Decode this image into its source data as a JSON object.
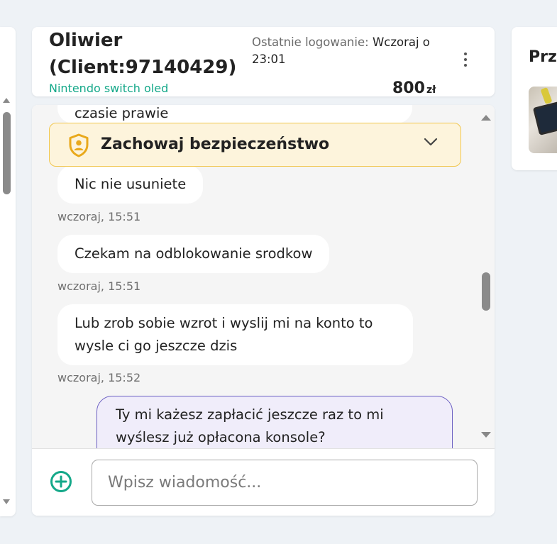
{
  "header": {
    "client_name": "Oliwier (Client:97140429)",
    "product": "Nintendo switch oled",
    "last_login_label": "Ostatnie logowanie:",
    "last_login_value": "Wczoraj o 23:01",
    "price": "800",
    "currency": "zł",
    "menu_icon": "kebab-vertical-icon"
  },
  "right_panel": {
    "title": "Prze",
    "thumbnail": "nintendo-switch-photo"
  },
  "safety_banner": {
    "label": "Zachowaj bezpieczeństwo",
    "icon": "shield-user-icon",
    "chevron_icon": "chevron-down-icon",
    "accent": "#f1c64d",
    "background": "#fdf4dc"
  },
  "messages": [
    {
      "direction": "in",
      "text": "czasie prawie"
    },
    {
      "direction": "in",
      "text": "Nic nie usuniete"
    },
    {
      "direction": "in",
      "timestamp": "wczoraj, 15:51"
    },
    {
      "direction": "in",
      "text": "Czekam na odblokowanie srodkow"
    },
    {
      "direction": "in",
      "timestamp": "wczoraj, 15:51"
    },
    {
      "direction": "in",
      "text": "Lub zrob sobie wzrot i wyslij mi na konto to wysle ci go jeszcze dzis"
    },
    {
      "direction": "in",
      "timestamp": "wczoraj, 15:52"
    },
    {
      "direction": "out",
      "text": "Ty mi każesz zapłacić jeszcze raz to mi wyślesz już opłacona konsole?"
    }
  ],
  "composer": {
    "placeholder": "Wpisz wiadomość...",
    "value": "",
    "add_icon": "plus-circle-icon",
    "accent": "#14a889"
  },
  "colors": {
    "page_bg": "#eef2f6",
    "chat_bg": "#f5f5f5",
    "outgoing_bubble_bg": "#f0edfa",
    "outgoing_bubble_border": "#6b5fc2",
    "product_link": "#14a889"
  }
}
